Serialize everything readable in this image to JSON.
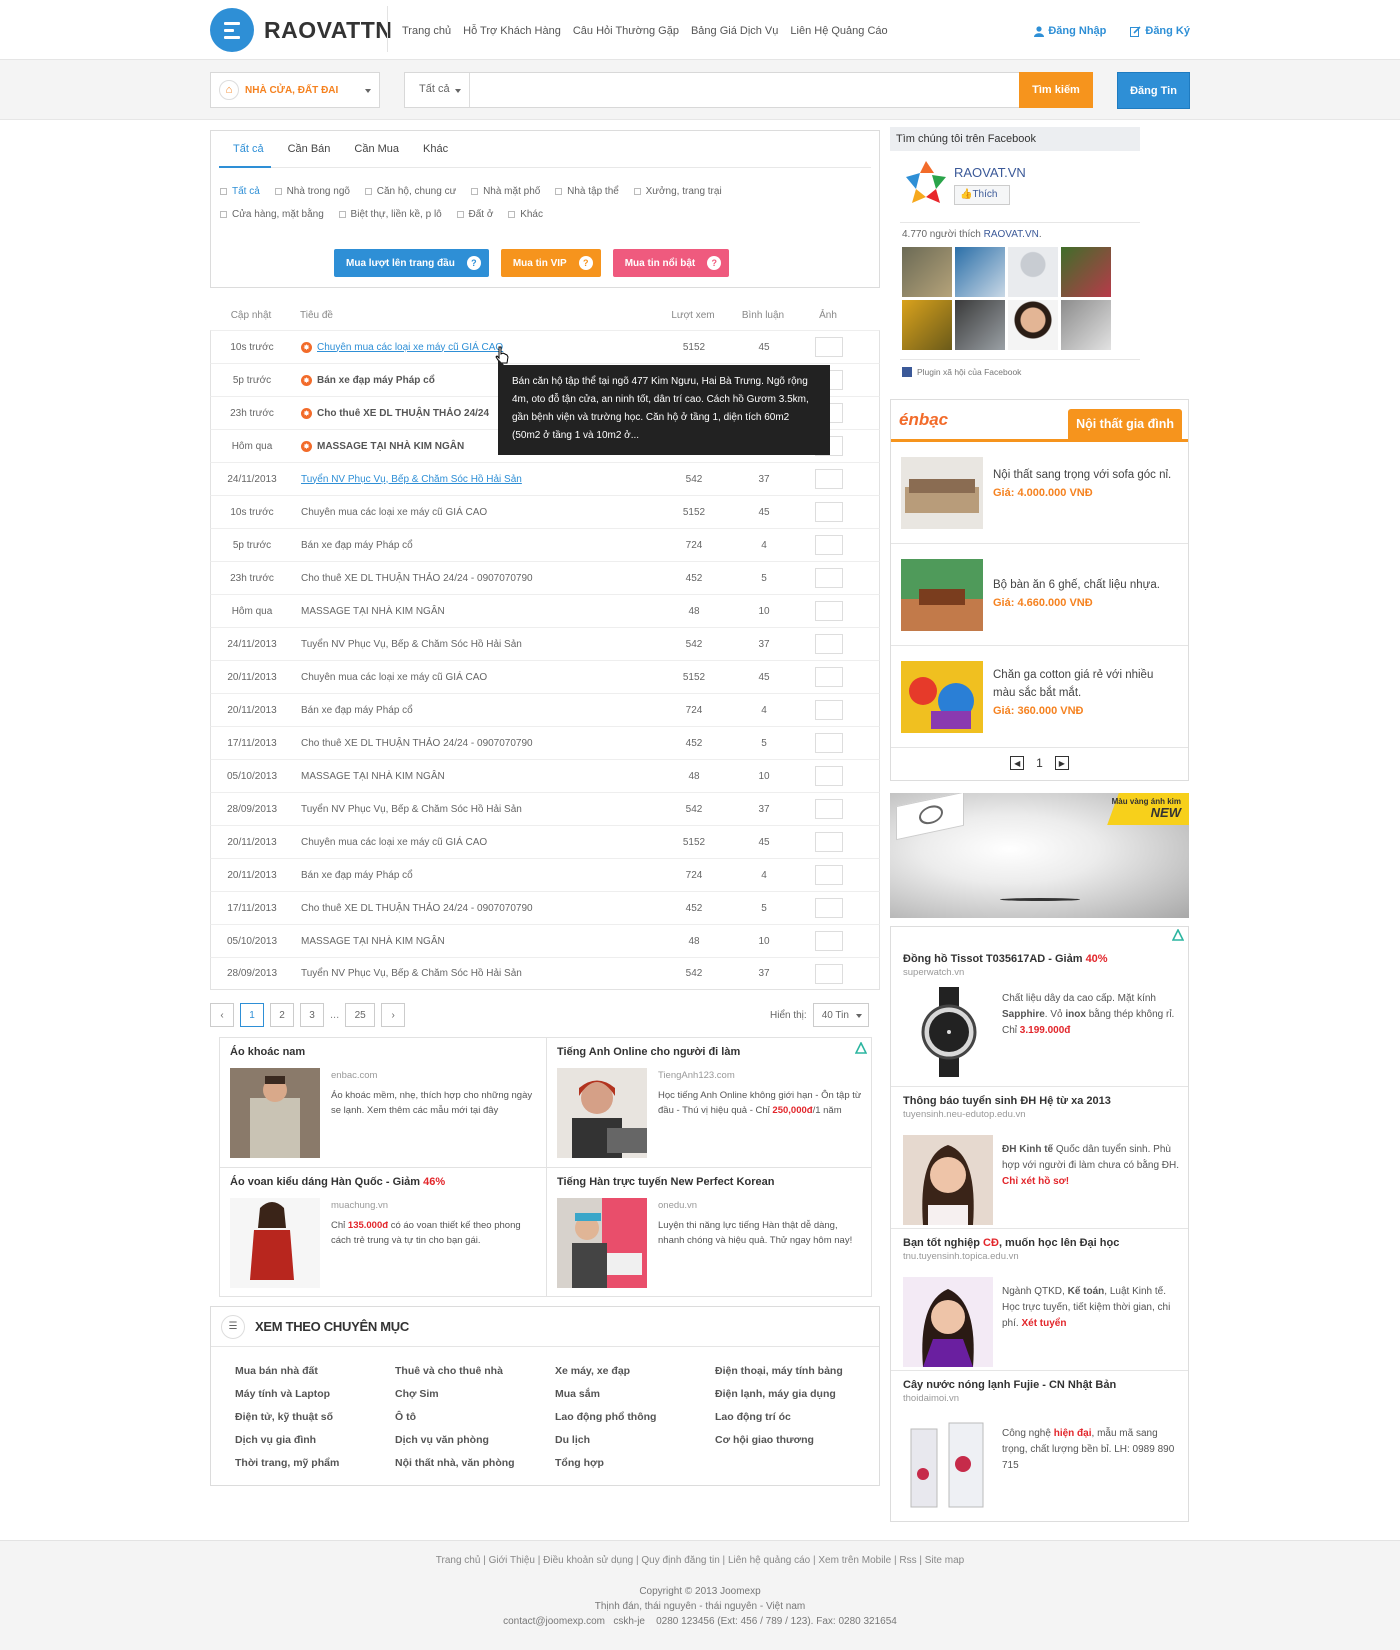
{
  "header": {
    "logo_text": "RAOVATTN",
    "nav": [
      "Trang chủ",
      "Hỗ Trợ Khách Hàng",
      "Câu Hỏi Thường Gặp",
      "Bảng Giá Dịch Vụ",
      "Liên Hệ Quảng Cáo"
    ],
    "login": "Đăng Nhập",
    "register": "Đăng Ký"
  },
  "search": {
    "category": "NHÀ CỬA, ĐẤT ĐAI",
    "scope": "Tất cả",
    "button": "Tìm kiếm",
    "post_button": "Đăng Tin"
  },
  "filter": {
    "tabs": [
      "Tất cả",
      "Cần Bán",
      "Cần Mua",
      "Khác"
    ],
    "subcats": [
      "Tất cả",
      "Nhà trong ngõ",
      "Căn hộ, chung cư",
      "Nhà mặt phố",
      "Nhà tập thể",
      "Xưởng, trang trại",
      "Cửa hàng, mặt bằng",
      "Biệt thự, liền kề, p lô",
      "Đất ở",
      "Khác"
    ],
    "buy_buttons": [
      "Mua lượt lên trang đầu",
      "Mua tin VIP",
      "Mua tin nổi bật"
    ]
  },
  "listing": {
    "headers": [
      "Cập nhật",
      "Tiêu đề",
      "Lượt xem",
      "Bình luận",
      "Ảnh"
    ],
    "rows": [
      {
        "time": "10s trước",
        "title": "Chuyên mua các loại xe máy cũ GIÁ CAO",
        "views": "5152",
        "comments": "45"
      },
      {
        "time": "5p trước",
        "title": "Bán xe đạp máy Pháp cổ",
        "views": "",
        "comments": ""
      },
      {
        "time": "23h trước",
        "title": "Cho thuê XE DL THUẬN THẢO 24/24",
        "views": "",
        "comments": ""
      },
      {
        "time": "Hôm qua",
        "title": "MASSAGE TẠI NHÀ KIM NGÂN",
        "views": "",
        "comments": ""
      },
      {
        "time": "24/11/2013",
        "title": "Tuyển NV Phục Vụ, Bếp & Chăm Sóc Hồ Hải Sản",
        "views": "542",
        "comments": "37"
      },
      {
        "time": "10s trước",
        "title": "Chuyên mua các loại xe máy cũ GIÁ CAO",
        "views": "5152",
        "comments": "45"
      },
      {
        "time": "5p trước",
        "title": "Bán xe đạp máy Pháp cổ",
        "views": "724",
        "comments": "4"
      },
      {
        "time": "23h trước",
        "title": "Cho thuê XE DL THUẬN THẢO 24/24 - 0907070790",
        "views": "452",
        "comments": "5"
      },
      {
        "time": "Hôm qua",
        "title": "MASSAGE TẠI NHÀ KIM NGÂN",
        "views": "48",
        "comments": "10"
      },
      {
        "time": "24/11/2013",
        "title": "Tuyển NV Phục Vụ, Bếp & Chăm Sóc Hồ Hải Sản",
        "views": "542",
        "comments": "37"
      },
      {
        "time": "20/11/2013",
        "title": "Chuyên mua các loại xe máy cũ GIÁ CAO",
        "views": "5152",
        "comments": "45"
      },
      {
        "time": "20/11/2013",
        "title": "Bán xe đạp máy Pháp cổ",
        "views": "724",
        "comments": "4"
      },
      {
        "time": "17/11/2013",
        "title": "Cho thuê XE DL THUẬN THẢO 24/24 - 0907070790",
        "views": "452",
        "comments": "5"
      },
      {
        "time": "05/10/2013",
        "title": "MASSAGE TẠI NHÀ KIM NGÂN",
        "views": "48",
        "comments": "10"
      },
      {
        "time": "28/09/2013",
        "title": "Tuyển NV Phục Vụ, Bếp & Chăm Sóc Hồ Hải Sản",
        "views": "542",
        "comments": "37"
      },
      {
        "time": "20/11/2013",
        "title": "Chuyên mua các loại xe máy cũ GIÁ CAO",
        "views": "5152",
        "comments": "45"
      },
      {
        "time": "20/11/2013",
        "title": "Bán xe đạp máy Pháp cổ",
        "views": "724",
        "comments": "4"
      },
      {
        "time": "17/11/2013",
        "title": "Cho thuê XE DL THUẬN THẢO 24/24 - 0907070790",
        "views": "452",
        "comments": "5"
      },
      {
        "time": "05/10/2013",
        "title": "MASSAGE TẠI NHÀ KIM NGÂN",
        "views": "48",
        "comments": "10"
      },
      {
        "time": "28/09/2013",
        "title": "Tuyển NV Phục Vụ, Bếp & Chăm Sóc Hồ Hải Sản",
        "views": "542",
        "comments": "37"
      }
    ],
    "tooltip": "Bán căn hộ tập thể tại ngõ 477 Kim Ngưu, Hai Bà Trưng. Ngõ rộng 4m, oto đỗ tận cửa, an ninh tốt, dân trí cao. Cách hồ Gươm 3.5km, gần bệnh viện và trường học. Căn hộ ở tầng 1, diện tích 60m2 (50m2 ở tầng 1 và 10m2 ở..."
  },
  "pagination": {
    "pages": [
      "1",
      "2",
      "3",
      "25"
    ],
    "dots": "...",
    "show_label": "Hiển thị:",
    "show_value": "40 Tin"
  },
  "ads": [
    {
      "title": "Áo khoác nam",
      "source": "enbac.com",
      "desc": "Áo khoác mềm, nhẹ, thích hợp cho những ngày se lạnh. Xem thêm các mẫu mới tại đây"
    },
    {
      "title": "Tiếng Anh Online cho người đi làm",
      "source": "TiengAnh123.com",
      "desc_pre": "Học tiếng Anh Online không giới hạn - Ôn tập từ đầu - Thú vị hiệu quả - Chỉ ",
      "desc_red": "250,000đ",
      "desc_post": "/1 năm"
    },
    {
      "title_pre": "Áo voan kiểu dáng Hàn Quốc - Giảm ",
      "title_red": "46%",
      "source": "muachung.vn",
      "desc_pre": "Chỉ ",
      "desc_red": "135.000đ",
      "desc_post": " có áo voan thiết kế theo phong cách trẻ trung và tự tin cho bạn gái."
    },
    {
      "title": "Tiếng Hàn trực tuyến New Perfect Korean",
      "source": "onedu.vn",
      "desc": "Luyện thi năng lực tiếng Hàn thật dễ dàng, nhanh chóng và hiệu quả. Thử ngay hôm nay!"
    }
  ],
  "categories": {
    "title": "XEM THEO CHUYÊN MỤC",
    "items": [
      "Mua bán nhà đất",
      "Thuê và cho thuê nhà",
      "Xe máy, xe đạp",
      "Điện thoại, máy tính bảng",
      "Máy tính và Laptop",
      "Chợ Sim",
      "Mua sắm",
      "Điện lạnh, máy gia dụng",
      "Điện tử, kỹ thuật số",
      "Ô tô",
      "Lao động phổ thông",
      "Lao động trí óc",
      "Dịch vụ gia đình",
      "Dịch vụ văn phòng",
      "Du lịch",
      "Cơ hội giao thương",
      "Thời trang, mỹ phẩm",
      "Nội thất nhà, văn phòng",
      "Tổng hợp"
    ]
  },
  "facebook": {
    "heading": "Tìm chúng tôi trên Facebook",
    "page_name": "RAOVAT.VN",
    "like_button": "Thích",
    "count_pre": "4.770 người thích ",
    "count_link": "RAOVAT.VN",
    "count_post": ".",
    "plugin": "Plugin xã hội của Facebook"
  },
  "enbac": {
    "logo": "énbạc",
    "tab": "Nội thất gia đình",
    "items": [
      {
        "text": "Nội thất sang trọng với sofa góc nỉ.",
        "price": "Giá: 4.000.000 VNĐ"
      },
      {
        "text": "Bộ bàn ăn 6 ghế, chất liệu nhựa.",
        "price": "Giá: 4.660.000 VNĐ"
      },
      {
        "text": "Chăn ga cotton giá rẻ với nhiều màu sắc bắt mắt.",
        "price": "Giá: 360.000 VNĐ"
      }
    ],
    "page": "1"
  },
  "banner": {
    "tag_line": "Màu vàng ánh kim",
    "tag_new": "NEW"
  },
  "right_ads": [
    {
      "title_pre": "Đồng hồ Tissot T035617AD - Giảm ",
      "title_red": "40%",
      "source": "superwatch.vn",
      "desc_html": "Chất liệu dây da cao cấp. Mặt kính <b>Sapphire</b>. Vỏ <b>inox</b> bằng thép không rỉ. Chỉ <span class='red'>3.199.000đ</span>"
    },
    {
      "title": "Thông báo tuyển sinh ĐH Hệ từ xa 2013",
      "source": "tuyensinh.neu-edutop.edu.vn",
      "desc_html": "<b>ĐH Kinh tế</b> Quốc dân tuyển sinh. Phù hợp với người đi làm chưa có bằng ĐH. <span class='red'>Chỉ xét hồ sơ!</span>"
    },
    {
      "title_pre": "Bạn tốt nghiệp ",
      "title_red": "CĐ",
      "title_post": ", muốn học lên Đại học",
      "source": "tnu.tuyensinh.topica.edu.vn",
      "desc_html": "Ngành QTKD, <b>Kế toán</b>, Luật Kinh tế. Học trực tuyến, tiết kiệm thời gian, chi phí. <span class='red'>Xét tuyển</span>"
    },
    {
      "title": "Cây nước nóng lạnh Fujie - CN Nhật Bản",
      "source": "thoidaimoi.vn",
      "desc_html": "Công nghệ <span class='red'>hiện đại</span>, mẫu mã sang trọng, chất lượng bền bỉ. LH: 0989 890 715"
    }
  ],
  "footer": {
    "links": [
      "Trang chủ",
      "Giới Thiệu",
      "Điều khoản sử dụng",
      "Quy định đăng tin",
      "Liên hệ quảng cáo",
      "Xem trên Mobile",
      "Rss",
      "Site map"
    ],
    "copyright": "Copyright © 2013 Joomexp",
    "address": "Thịnh đán, thái nguyên - thái nguyên - Việt nam",
    "contact": "contact@joomexp.com   cskh-je    0280 123456 (Ext: 456 / 789 / 123). Fax: 0280 321654"
  },
  "colors": {
    "primary": "#2e8fd6",
    "orange": "#f6941d",
    "pink": "#ef5a7e",
    "red": "#e2262b"
  }
}
